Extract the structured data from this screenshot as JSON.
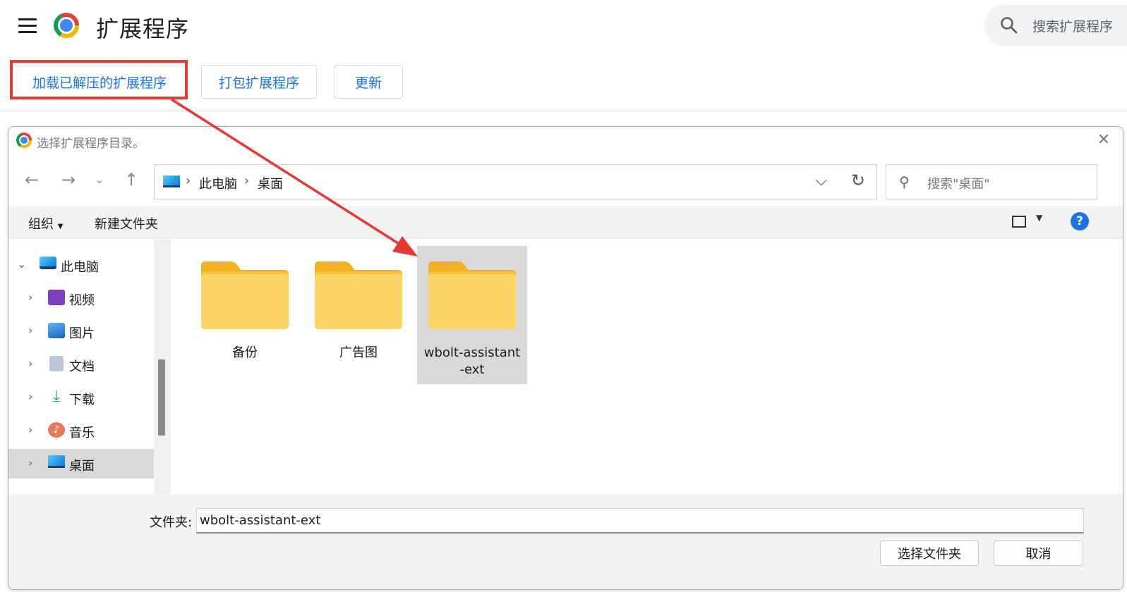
{
  "header": {
    "title": "扩展程序",
    "search_placeholder": "搜索扩展程序"
  },
  "actions": {
    "load_unpacked": "加载已解压的扩展程序",
    "pack": "打包扩展程序",
    "update": "更新"
  },
  "dialog": {
    "title": "选择扩展程序目录。",
    "breadcrumb": [
      "此电脑",
      "桌面"
    ],
    "search_placeholder": "搜索\"桌面\"",
    "toolbar": {
      "organize": "组织",
      "new_folder": "新建文件夹"
    },
    "sidebar": [
      {
        "label": "此电脑",
        "icon": "pc-icon",
        "expanded": true
      },
      {
        "label": "视频",
        "icon": "video-icon"
      },
      {
        "label": "图片",
        "icon": "pictures-icon"
      },
      {
        "label": "文档",
        "icon": "documents-icon"
      },
      {
        "label": "下载",
        "icon": "download-icon"
      },
      {
        "label": "音乐",
        "icon": "music-icon"
      },
      {
        "label": "桌面",
        "icon": "desktop-icon",
        "selected": true
      }
    ],
    "folders": [
      {
        "name": "备份"
      },
      {
        "name": "广告图"
      },
      {
        "name_line1": "wbolt-assistant",
        "name_line2": "-ext",
        "selected": true
      }
    ],
    "folder_label": "文件夹:",
    "folder_value": "wbolt-assistant-ext",
    "select_button": "选择文件夹",
    "cancel_button": "取消"
  },
  "colors": {
    "accent": "#1a73e8",
    "highlight": "#e53935",
    "folder": "#f9c23c"
  }
}
